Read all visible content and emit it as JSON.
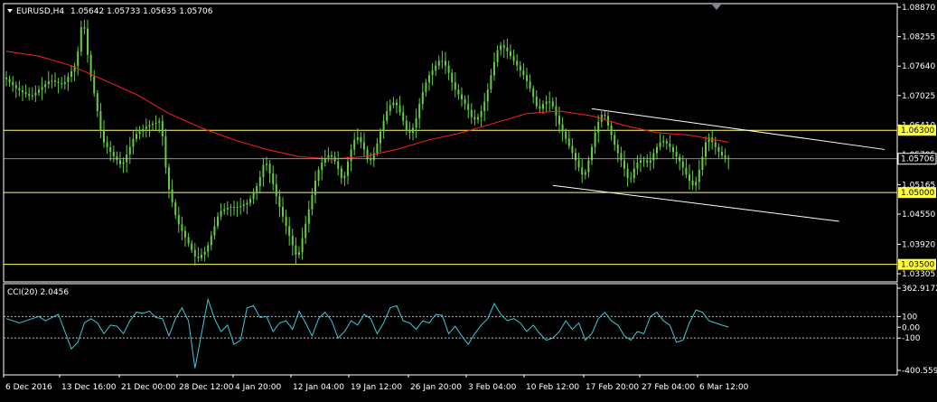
{
  "window": {
    "symbol_title": "EURUSD,H4",
    "ohlc": "1.05642 1.05733 1.05635 1.05706"
  },
  "colors": {
    "background": "#000000",
    "frame": "#ffffff",
    "candles": "#66cc44",
    "moving_average": "#ff2020",
    "horizontal_levels": "#ffff66",
    "price_marker": "#c0c0c0",
    "trend_channel": "#ffffff",
    "cci_line": "#40c8d8",
    "cci_levels": "#c0c0c0",
    "highlight_label_bg": "#ffff40"
  },
  "chart_data": [
    {
      "type": "candlestick",
      "symbol": "EURUSD",
      "timeframe": "H4",
      "ylim": [
        1.03305,
        1.0887
      ],
      "y_tick_labels": [
        "1.08870",
        "1.08255",
        "1.07640",
        "1.07025",
        "1.06410",
        "1.05795",
        "1.05165",
        "1.04550",
        "1.03920",
        "1.03305"
      ],
      "x_tick_labels": [
        "6 Dec 2016",
        "13 Dec 16:00",
        "21 Dec 00:00",
        "28 Dec 12:00",
        "4 Jan 20:00",
        "12 Jan 04:00",
        "19 Jan 12:00",
        "26 Jan 20:00",
        "3 Feb 04:00",
        "10 Feb 12:00",
        "17 Feb 20:00",
        "27 Feb 04:00",
        "6 Mar 12:00"
      ],
      "current_price": 1.05706,
      "current_price_label": "1.05706",
      "horizontal_levels": [
        {
          "price": 1.063,
          "label": "1.06300"
        },
        {
          "price": 1.05,
          "label": "1.05000"
        },
        {
          "price": 1.035,
          "label": "1.03500"
        }
      ],
      "price_path": [
        [
          0,
          1.074
        ],
        [
          4,
          1.0715
        ],
        [
          8,
          1.07
        ],
        [
          14,
          1.0735
        ],
        [
          18,
          1.0725
        ],
        [
          22,
          1.077
        ],
        [
          24,
          1.087
        ],
        [
          26,
          1.076
        ],
        [
          28,
          1.069
        ],
        [
          30,
          1.061
        ],
        [
          33,
          1.058
        ],
        [
          36,
          1.0555
        ],
        [
          40,
          1.062
        ],
        [
          44,
          1.064
        ],
        [
          48,
          1.065
        ],
        [
          50,
          1.052
        ],
        [
          53,
          1.044
        ],
        [
          56,
          1.04
        ],
        [
          59,
          1.036
        ],
        [
          62,
          1.038
        ],
        [
          64,
          1.042
        ],
        [
          66,
          1.046
        ],
        [
          69,
          1.047
        ],
        [
          72,
          1.047
        ],
        [
          75,
          1.048
        ],
        [
          78,
          1.052
        ],
        [
          80,
          1.057
        ],
        [
          82,
          1.053
        ],
        [
          84,
          1.048
        ],
        [
          86,
          1.044
        ],
        [
          88,
          1.04
        ],
        [
          90,
          1.036
        ],
        [
          92,
          1.042
        ],
        [
          94,
          1.048
        ],
        [
          96,
          1.054
        ],
        [
          98,
          1.057
        ],
        [
          100,
          1.058
        ],
        [
          102,
          1.056
        ],
        [
          104,
          1.052
        ],
        [
          106,
          1.058
        ],
        [
          108,
          1.062
        ],
        [
          110,
          1.06
        ],
        [
          112,
          1.056
        ],
        [
          114,
          1.059
        ],
        [
          116,
          1.064
        ],
        [
          118,
          1.068
        ],
        [
          120,
          1.069
        ],
        [
          122,
          1.066
        ],
        [
          124,
          1.062
        ],
        [
          126,
          1.064
        ],
        [
          128,
          1.07
        ],
        [
          130,
          1.074
        ],
        [
          132,
          1.076
        ],
        [
          134,
          1.078
        ],
        [
          136,
          1.076
        ],
        [
          138,
          1.072
        ],
        [
          140,
          1.07
        ],
        [
          142,
          1.068
        ],
        [
          144,
          1.065
        ],
        [
          146,
          1.066
        ],
        [
          148,
          1.07
        ],
        [
          150,
          1.076
        ],
        [
          152,
          1.081
        ],
        [
          154,
          1.08
        ],
        [
          156,
          1.078
        ],
        [
          158,
          1.076
        ],
        [
          160,
          1.074
        ],
        [
          162,
          1.071
        ],
        [
          164,
          1.067
        ],
        [
          166,
          1.069
        ],
        [
          168,
          1.069
        ],
        [
          170,
          1.065
        ],
        [
          172,
          1.062
        ],
        [
          174,
          1.059
        ],
        [
          176,
          1.056
        ],
        [
          178,
          1.053
        ],
        [
          180,
          1.058
        ],
        [
          182,
          1.064
        ],
        [
          184,
          1.067
        ],
        [
          186,
          1.063
        ],
        [
          188,
          1.059
        ],
        [
          190,
          1.056
        ],
        [
          192,
          1.052
        ],
        [
          194,
          1.056
        ],
        [
          196,
          1.057
        ],
        [
          198,
          1.056
        ],
        [
          200,
          1.059
        ],
        [
          202,
          1.061
        ],
        [
          204,
          1.06
        ],
        [
          206,
          1.058
        ],
        [
          208,
          1.056
        ],
        [
          210,
          1.053
        ],
        [
          212,
          1.051
        ],
        [
          214,
          1.056
        ],
        [
          216,
          1.062
        ],
        [
          218,
          1.06
        ],
        [
          220,
          1.058
        ],
        [
          222,
          1.057
        ]
      ],
      "moving_average_path": [
        [
          0,
          1.0795
        ],
        [
          10,
          1.0785
        ],
        [
          20,
          1.0765
        ],
        [
          30,
          1.0735
        ],
        [
          40,
          1.0705
        ],
        [
          50,
          1.0665
        ],
        [
          60,
          1.0635
        ],
        [
          70,
          1.061
        ],
        [
          80,
          1.059
        ],
        [
          90,
          1.0575
        ],
        [
          100,
          1.057
        ],
        [
          110,
          1.0575
        ],
        [
          120,
          1.059
        ],
        [
          130,
          1.061
        ],
        [
          140,
          1.0625
        ],
        [
          150,
          1.0645
        ],
        [
          160,
          1.0665
        ],
        [
          170,
          1.067
        ],
        [
          180,
          1.066
        ],
        [
          190,
          1.064
        ],
        [
          200,
          1.0625
        ],
        [
          210,
          1.062
        ],
        [
          222,
          1.0605
        ]
      ],
      "trend_lines": [
        {
          "name": "channel-upper",
          "from": [
            180,
            1.0675
          ],
          "to": [
            270,
            1.059
          ]
        },
        {
          "name": "channel-lower",
          "from": [
            168,
            1.0515
          ],
          "to": [
            256,
            1.044
          ]
        }
      ]
    },
    {
      "type": "line",
      "title": "CCI(20) 2.0456",
      "ylim": [
        -400.5593,
        362.9172
      ],
      "y_tick_labels": [
        "362.9172",
        "100",
        "0.00",
        "-100",
        "-400.5593"
      ],
      "levels": [
        100,
        -100
      ],
      "series": [
        {
          "values": [
            [
              0,
              80
            ],
            [
              4,
              40
            ],
            [
              8,
              80
            ],
            [
              10,
              100
            ],
            [
              12,
              60
            ],
            [
              16,
              120
            ],
            [
              18,
              -40
            ],
            [
              20,
              -200
            ],
            [
              22,
              -140
            ],
            [
              24,
              40
            ],
            [
              26,
              80
            ],
            [
              28,
              40
            ],
            [
              30,
              -60
            ],
            [
              32,
              20
            ],
            [
              34,
              10
            ],
            [
              36,
              -60
            ],
            [
              38,
              60
            ],
            [
              40,
              140
            ],
            [
              42,
              130
            ],
            [
              44,
              150
            ],
            [
              46,
              90
            ],
            [
              48,
              80
            ],
            [
              50,
              -80
            ],
            [
              52,
              80
            ],
            [
              54,
              180
            ],
            [
              56,
              60
            ],
            [
              58,
              -380
            ],
            [
              60,
              -60
            ],
            [
              62,
              260
            ],
            [
              64,
              80
            ],
            [
              66,
              -40
            ],
            [
              68,
              20
            ],
            [
              70,
              -160
            ],
            [
              72,
              -120
            ],
            [
              74,
              180
            ],
            [
              76,
              200
            ],
            [
              78,
              90
            ],
            [
              80,
              100
            ],
            [
              82,
              -40
            ],
            [
              84,
              40
            ],
            [
              86,
              60
            ],
            [
              88,
              -20
            ],
            [
              90,
              150
            ],
            [
              92,
              40
            ],
            [
              94,
              -80
            ],
            [
              96,
              80
            ],
            [
              98,
              140
            ],
            [
              100,
              60
            ],
            [
              102,
              -100
            ],
            [
              104,
              -40
            ],
            [
              106,
              60
            ],
            [
              108,
              20
            ],
            [
              110,
              120
            ],
            [
              112,
              80
            ],
            [
              114,
              -60
            ],
            [
              116,
              40
            ],
            [
              118,
              180
            ],
            [
              120,
              200
            ],
            [
              122,
              60
            ],
            [
              124,
              40
            ],
            [
              126,
              -20
            ],
            [
              128,
              60
            ],
            [
              130,
              40
            ],
            [
              132,
              120
            ],
            [
              134,
              110
            ],
            [
              136,
              -60
            ],
            [
              138,
              10
            ],
            [
              140,
              -80
            ],
            [
              142,
              -160
            ],
            [
              144,
              -60
            ],
            [
              146,
              20
            ],
            [
              148,
              80
            ],
            [
              150,
              220
            ],
            [
              152,
              120
            ],
            [
              154,
              60
            ],
            [
              156,
              80
            ],
            [
              158,
              40
            ],
            [
              160,
              -40
            ],
            [
              162,
              20
            ],
            [
              164,
              -60
            ],
            [
              166,
              -120
            ],
            [
              168,
              -100
            ],
            [
              170,
              -40
            ],
            [
              172,
              60
            ],
            [
              174,
              -20
            ],
            [
              176,
              40
            ],
            [
              178,
              -120
            ],
            [
              180,
              -60
            ],
            [
              182,
              80
            ],
            [
              184,
              140
            ],
            [
              186,
              60
            ],
            [
              188,
              20
            ],
            [
              190,
              -80
            ],
            [
              192,
              -120
            ],
            [
              194,
              -40
            ],
            [
              196,
              -60
            ],
            [
              198,
              100
            ],
            [
              200,
              140
            ],
            [
              202,
              60
            ],
            [
              204,
              20
            ],
            [
              206,
              -140
            ],
            [
              208,
              -120
            ],
            [
              210,
              40
            ],
            [
              212,
              160
            ],
            [
              214,
              140
            ],
            [
              216,
              60
            ],
            [
              218,
              40
            ],
            [
              220,
              20
            ],
            [
              222,
              2
            ]
          ]
        }
      ]
    }
  ]
}
